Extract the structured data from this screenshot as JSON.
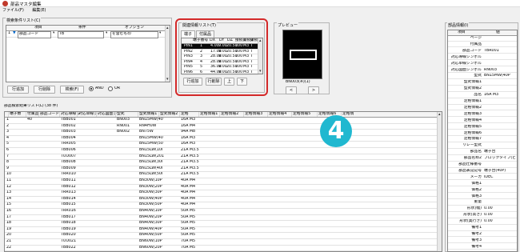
{
  "title": "部品マスタ編集",
  "menu": [
    "ファイル(F)",
    "編集(E)"
  ],
  "search_cond": {
    "caption": "検索条件リスト(C)",
    "headers": [
      "項目",
      "条件",
      "オプション"
    ],
    "row": {
      "marker": "1",
      "item": "部品コード",
      "cond": "TB",
      "opt": "を含むもの"
    },
    "buttons": [
      "行追加",
      "行削除",
      "検索(F)"
    ],
    "radio_and": "AND",
    "radio_or": "OR"
  },
  "related": {
    "caption": "関連情報リスト(T)",
    "tabs": [
      "端子",
      "付属品"
    ],
    "headers": [
      "端子番号",
      "DX",
      "DY",
      "DZ",
      "接続1",
      "接続2",
      "接続3",
      "接続4",
      "接続5",
      "接続6"
    ],
    "rows": [
      [
        "PIN1",
        "1",
        "4.00",
        "9.00",
        "20.50",
        "100",
        "M3",
        "T",
        "U"
      ],
      [
        "PIN2",
        "2",
        "17.00",
        "9.00",
        "20.50",
        "100",
        "M3",
        "T",
        "U"
      ],
      [
        "PIN3",
        "3",
        "28.00",
        "9.00",
        "20.50",
        "100",
        "M3",
        "T",
        "U"
      ],
      [
        "PIN4",
        "4",
        "28.00",
        "9.00",
        "20.50",
        "100",
        "M3",
        "T",
        "U"
      ],
      [
        "PIN5",
        "5",
        "36.00",
        "9.00",
        "20.50",
        "100",
        "M3",
        "T",
        "U"
      ],
      [
        "PIN6",
        "6",
        "44.00",
        "9.00",
        "20.50",
        "100",
        "M3",
        "T",
        "U"
      ]
    ],
    "buttons": [
      "行追加",
      "行削除",
      "上",
      "下"
    ]
  },
  "preview": {
    "caption": "プレビュー",
    "label": "BN003(※)(1)",
    "nav_prev": "<",
    "nav_next": ">"
  },
  "props": {
    "caption": "部品情報(I)",
    "headers": [
      "項目",
      "値"
    ],
    "rows": [
      [
        "ページ",
        ""
      ],
      [
        "付属品",
        ""
      ],
      [
        "部品コード",
        "TBR001"
      ],
      [
        "対応導線シンボル",
        ""
      ],
      [
        "対応単線シンボル",
        ""
      ],
      [
        "対応図面シンボル",
        "RN003"
      ],
      [
        "型式",
        "BN15MW(40P"
      ],
      [
        "型式情報1",
        ""
      ],
      [
        "型式情報2",
        ""
      ],
      [
        "品名",
        "16A M3"
      ],
      [
        "定格情報1",
        ""
      ],
      [
        "定格情報2",
        ""
      ],
      [
        "定格情報3",
        ""
      ],
      [
        "定格情報4",
        ""
      ],
      [
        "定格情報5",
        ""
      ],
      [
        "定格情報6",
        ""
      ],
      [
        "定格情報7",
        ""
      ],
      [
        "リレー型式",
        ""
      ],
      [
        "部品名",
        "端子台"
      ],
      [
        "部品名称2",
        "ブロックタイプ(ビ"
      ],
      [
        "部品仕様番号",
        ""
      ],
      [
        "部品表記記号",
        "端子台(40P)"
      ],
      [
        "メーカ",
        "IDEC"
      ],
      [
        "価格1",
        ""
      ],
      [
        "価格2",
        ""
      ],
      [
        "価格3",
        ""
      ],
      [
        "重量",
        ""
      ],
      [
        "形状(幅)",
        "0.00"
      ],
      [
        "形状(高さ)",
        "0.00"
      ],
      [
        "形状(奥行き)",
        "0.00"
      ],
      [
        "備考1",
        ""
      ],
      [
        "備考2",
        ""
      ],
      [
        "備考3",
        ""
      ],
      [
        "備考4",
        ""
      ]
    ]
  },
  "results": {
    "caption": "部品検索結果リスト(L)  (38 件)",
    "headers": [
      "端子数",
      "付属品",
      "部品コード",
      "対応導線シ",
      "対応単線シ",
      "対応図面シ",
      "型式",
      "型式情報1",
      "型式情報2",
      "定格",
      "定格情報1",
      "定格情報2",
      "定格情報3",
      "定格情報4",
      "定格情報5",
      "定格情報6",
      "定格情"
    ],
    "rows": [
      [
        "1",
        "40",
        "",
        "TBB001",
        "",
        "",
        "BN003",
        "BN15MW(40",
        "",
        "",
        "16A M3"
      ],
      [
        "2",
        "",
        "",
        "TBB002",
        "",
        "",
        "RN001",
        "RN4H0W",
        "",
        "",
        "16A M4"
      ],
      [
        "3",
        "",
        "",
        "TBB003",
        "",
        "",
        "BN002",
        "BN75W",
        "",
        "",
        "94A M8"
      ],
      [
        "4",
        "",
        "",
        "TBB004",
        "",
        "",
        "",
        "BN15MW(40",
        "",
        "",
        "16A M3"
      ],
      [
        "5",
        "",
        "",
        "TRR005",
        "",
        "",
        "",
        "BN15MW(50",
        "",
        "",
        "16A M3"
      ],
      [
        "6",
        "",
        "",
        "TBB006",
        "",
        "",
        "",
        "BN15LW(10I",
        "",
        "",
        "21A M3.5"
      ],
      [
        "7",
        "",
        "",
        "TUU007",
        "",
        "",
        "",
        "BN15LW(201",
        "",
        "",
        "21A M3.5"
      ],
      [
        "8",
        "",
        "",
        "TBB008",
        "",
        "",
        "",
        "BN15LW(30I",
        "",
        "",
        "21A M3.5"
      ],
      [
        "9",
        "",
        "",
        "TBB009",
        "",
        "",
        "",
        "BN15LW(40I",
        "",
        "",
        "21A M3.5"
      ],
      [
        "10",
        "",
        "",
        "TRR010",
        "",
        "",
        "",
        "BN15LW(50I",
        "",
        "",
        "21A M3.5"
      ],
      [
        "11",
        "",
        "",
        "TBB011",
        "",
        "",
        "",
        "BN30W(10P",
        "",
        "",
        "40A M4"
      ],
      [
        "12",
        "",
        "",
        "TBB012",
        "",
        "",
        "",
        "BN30W(20P",
        "",
        "",
        "40A M4"
      ],
      [
        "13",
        "",
        "",
        "TRR013",
        "",
        "",
        "",
        "BN30W(30P",
        "",
        "",
        "40A M4"
      ],
      [
        "14",
        "",
        "",
        "TBB014",
        "",
        "",
        "",
        "BN30W(40P",
        "",
        "",
        "40A M4"
      ],
      [
        "15",
        "",
        "",
        "TBB015",
        "",
        "",
        "",
        "BN30W(50P",
        "",
        "",
        "40A M4"
      ],
      [
        "16",
        "",
        "",
        "TRR016",
        "",
        "",
        "",
        "BN40W(10P",
        "",
        "",
        "50A M5"
      ],
      [
        "17",
        "",
        "",
        "TBB017",
        "",
        "",
        "",
        "BN40W(20P",
        "",
        "",
        "50A M5"
      ],
      [
        "18",
        "",
        "",
        "TBB018",
        "",
        "",
        "",
        "BN40W(30P",
        "",
        "",
        "50A M5"
      ],
      [
        "19",
        "",
        "",
        "TBB019",
        "",
        "",
        "",
        "BN40W(40P",
        "",
        "",
        "50A M5"
      ],
      [
        "20",
        "",
        "",
        "TBB020",
        "",
        "",
        "",
        "BN40W(50P",
        "",
        "",
        "50A M5"
      ],
      [
        "21",
        "",
        "",
        "TUU021",
        "",
        "",
        "",
        "BN60W(10P",
        "",
        "",
        "70A M5"
      ],
      [
        "22",
        "",
        "",
        "TBB022",
        "",
        "",
        "",
        "BN60W(20P",
        "",
        "",
        "70A M5"
      ]
    ]
  },
  "badge": "4"
}
